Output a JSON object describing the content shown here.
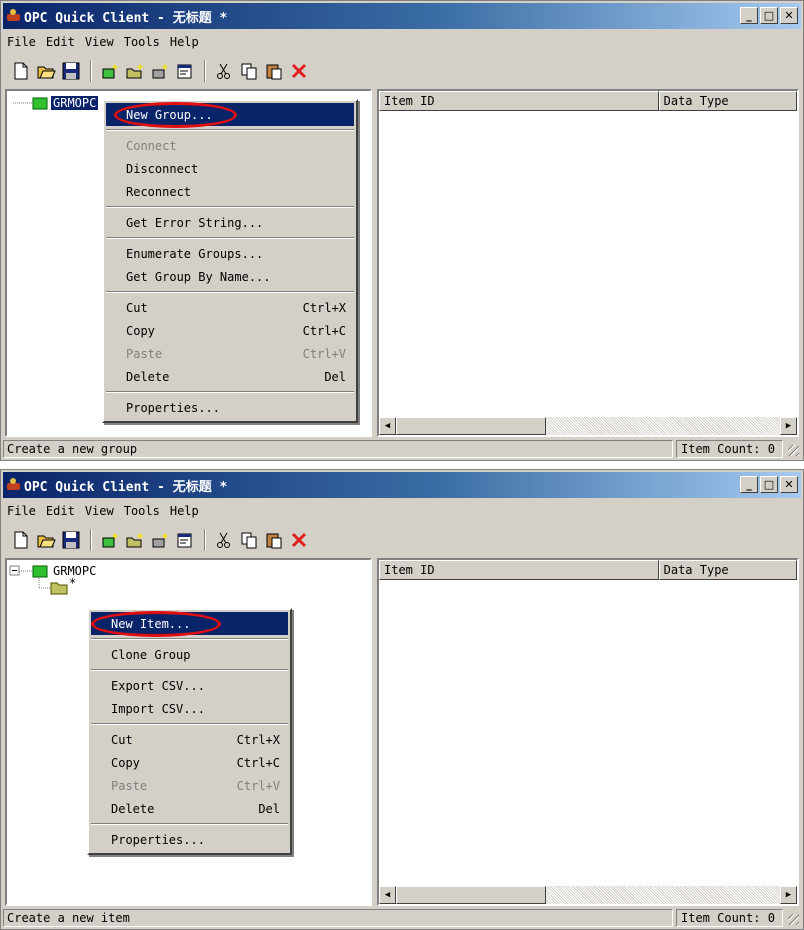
{
  "window1": {
    "title": "OPC Quick Client - 无标题 *",
    "menu": [
      "File",
      "Edit",
      "View",
      "Tools",
      "Help"
    ],
    "tree_root": "GRMOPC",
    "columns": [
      "Item ID",
      "Data Type"
    ],
    "status_text": "Create a new group",
    "item_count": "Item Count: 0",
    "context_menu": [
      {
        "label": "New Group...",
        "shortcut": "",
        "state": "highlighted"
      },
      {
        "sep": true
      },
      {
        "label": "Connect",
        "shortcut": "",
        "state": "disabled"
      },
      {
        "label": "Disconnect",
        "shortcut": "",
        "state": "enabled"
      },
      {
        "label": "Reconnect",
        "shortcut": "",
        "state": "enabled"
      },
      {
        "sep": true
      },
      {
        "label": "Get Error String...",
        "shortcut": "",
        "state": "enabled"
      },
      {
        "sep": true
      },
      {
        "label": "Enumerate Groups...",
        "shortcut": "",
        "state": "enabled"
      },
      {
        "label": "Get Group By Name...",
        "shortcut": "",
        "state": "enabled"
      },
      {
        "sep": true
      },
      {
        "label": "Cut",
        "shortcut": "Ctrl+X",
        "state": "enabled"
      },
      {
        "label": "Copy",
        "shortcut": "Ctrl+C",
        "state": "enabled"
      },
      {
        "label": "Paste",
        "shortcut": "Ctrl+V",
        "state": "disabled"
      },
      {
        "label": "Delete",
        "shortcut": "Del",
        "state": "enabled"
      },
      {
        "sep": true
      },
      {
        "label": "Properties...",
        "shortcut": "",
        "state": "enabled"
      }
    ]
  },
  "window2": {
    "title": "OPC Quick Client - 无标题 *",
    "menu": [
      "File",
      "Edit",
      "View",
      "Tools",
      "Help"
    ],
    "tree_root": "GRMOPC",
    "tree_child": "*",
    "columns": [
      "Item ID",
      "Data Type"
    ],
    "status_text": "Create a new item",
    "item_count": "Item Count: 0",
    "context_menu": [
      {
        "label": "New Item...",
        "shortcut": "",
        "state": "highlighted"
      },
      {
        "sep": true
      },
      {
        "label": "Clone Group",
        "shortcut": "",
        "state": "enabled"
      },
      {
        "sep": true
      },
      {
        "label": "Export CSV...",
        "shortcut": "",
        "state": "enabled"
      },
      {
        "label": "Import CSV...",
        "shortcut": "",
        "state": "enabled"
      },
      {
        "sep": true
      },
      {
        "label": "Cut",
        "shortcut": "Ctrl+X",
        "state": "enabled"
      },
      {
        "label": "Copy",
        "shortcut": "Ctrl+C",
        "state": "enabled"
      },
      {
        "label": "Paste",
        "shortcut": "Ctrl+V",
        "state": "disabled"
      },
      {
        "label": "Delete",
        "shortcut": "Del",
        "state": "enabled"
      },
      {
        "sep": true
      },
      {
        "label": "Properties...",
        "shortcut": "",
        "state": "enabled"
      }
    ]
  },
  "toolbar_icons": [
    "new-file-icon",
    "open-folder-icon",
    "save-icon",
    "new-server-icon",
    "new-group-icon",
    "new-item-icon",
    "properties-icon",
    "cut-icon",
    "copy-icon",
    "paste-icon",
    "delete-icon"
  ],
  "colors": {
    "titlebar": "#0a246a",
    "highlight": "#0a246a",
    "annotation_ring": "#e01010",
    "face": "#d4d0c8"
  }
}
